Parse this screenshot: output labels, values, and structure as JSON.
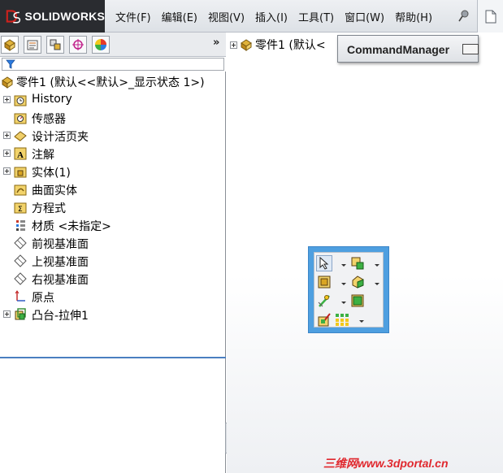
{
  "app": {
    "logo_text": "SOLIDWORKS",
    "brand_color": "#d0211c"
  },
  "menu": [
    {
      "label": "文件(F)"
    },
    {
      "label": "编辑(E)"
    },
    {
      "label": "视图(V)"
    },
    {
      "label": "插入(I)"
    },
    {
      "label": "工具(T)"
    },
    {
      "label": "窗口(W)"
    },
    {
      "label": "帮助(H)"
    }
  ],
  "panel": {
    "tabs": [
      "featuremanager-tab",
      "propertymanager-tab",
      "configurationmanager-tab",
      "dimxpert-tab",
      "display-manager-tab"
    ],
    "more_label": "»",
    "root_label": "零件1 (默认<<默认>_显示状态 1>)",
    "tree": [
      {
        "label": "History",
        "icon": "history-icon",
        "expandable": true
      },
      {
        "label": "传感器",
        "icon": "sensor-folder-icon",
        "expandable": false
      },
      {
        "label": "设计活页夹",
        "icon": "design-binder-icon",
        "expandable": true
      },
      {
        "label": "注解",
        "icon": "annotations-icon",
        "expandable": true
      },
      {
        "label": "实体(1)",
        "icon": "solid-bodies-icon",
        "expandable": true
      },
      {
        "label": "曲面实体",
        "icon": "surface-bodies-icon",
        "expandable": false
      },
      {
        "label": "方程式",
        "icon": "equations-icon",
        "expandable": false
      },
      {
        "label": "材质 <未指定>",
        "icon": "material-icon",
        "expandable": false
      },
      {
        "label": "前视基准面",
        "icon": "plane-icon",
        "expandable": false
      },
      {
        "label": "上视基准面",
        "icon": "plane-icon",
        "expandable": false
      },
      {
        "label": "右视基准面",
        "icon": "plane-icon",
        "expandable": false
      },
      {
        "label": "原点",
        "icon": "origin-icon",
        "expandable": false
      },
      {
        "label": "凸台-拉伸1",
        "icon": "extrude-icon",
        "expandable": true
      }
    ]
  },
  "graphics": {
    "tree_label": "零件1 (默认<",
    "command_manager_label": "CommandManager"
  },
  "watermark": "三维网www.3dportal.cn"
}
